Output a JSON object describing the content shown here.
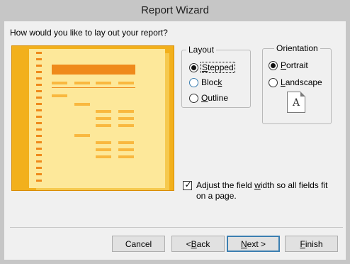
{
  "window": {
    "title": "Report Wizard"
  },
  "prompt": "How would you like to lay out your report?",
  "layout": {
    "label": "Layout",
    "options": [
      {
        "label": "Stepped",
        "selected": true
      },
      {
        "label": "Block",
        "selected": false
      },
      {
        "label": "Outline",
        "selected": false
      }
    ]
  },
  "orientation": {
    "label": "Orientation",
    "options": [
      {
        "label": "Portrait",
        "selected": true
      },
      {
        "label": "Landscape",
        "selected": false
      }
    ],
    "icon_letter": "A"
  },
  "adjust_width": {
    "label": "Adjust the field width so all fields fit on a page.",
    "checked": true
  },
  "buttons": {
    "cancel": "Cancel",
    "back": "< Back",
    "next": "Next >",
    "finish": "Finish"
  },
  "colors": {
    "preview_bg": "#f2b01c",
    "page_bg": "#fde89a",
    "title_bar_fill": "#ef8a1b",
    "field_fill": "#f9b83f"
  }
}
